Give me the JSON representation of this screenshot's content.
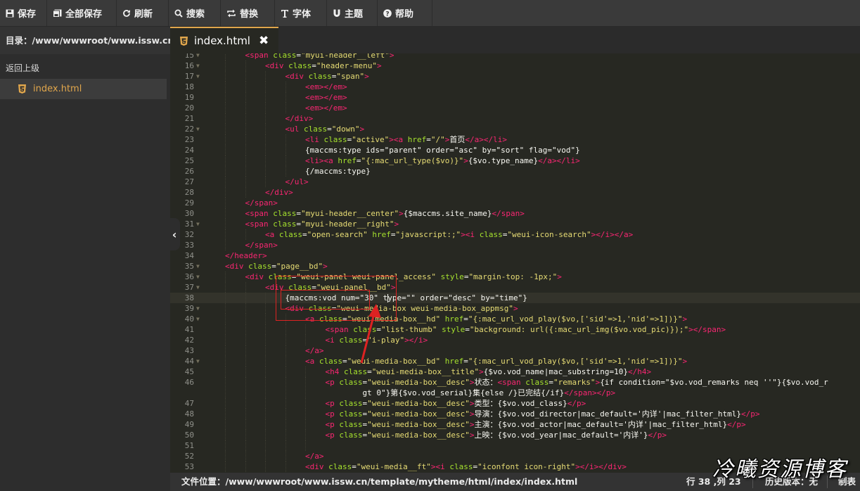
{
  "toolbar": {
    "buttons": [
      {
        "label": "保存",
        "icon": "save-icon"
      },
      {
        "label": "全部保存",
        "icon": "save-all-icon"
      },
      {
        "label": "刷新",
        "icon": "refresh-icon"
      },
      {
        "label": "搜索",
        "icon": "search-icon"
      },
      {
        "label": "替换",
        "icon": "replace-icon"
      },
      {
        "label": "字体",
        "icon": "font-icon"
      },
      {
        "label": "主题",
        "icon": "theme-icon"
      },
      {
        "label": "帮助",
        "icon": "help-icon"
      }
    ]
  },
  "sidebar": {
    "directory": "目录：/www/wwwroot/www.issw.cn/t...",
    "back_label": "返回上级",
    "files": [
      "index.html"
    ]
  },
  "tab": {
    "label": "index.html"
  },
  "editor": {
    "active_line": 38,
    "lines": [
      {
        "n": "15",
        "fold": true,
        "code": [
          [
            "t",
            "<span "
          ],
          [
            "a",
            "class"
          ],
          [
            "w",
            "="
          ],
          [
            "s",
            "\"myui-header__left\""
          ],
          [
            "t",
            ">"
          ]
        ]
      },
      {
        "n": "16",
        "fold": true,
        "code": [
          [
            "t",
            "<div "
          ],
          [
            "a",
            "class"
          ],
          [
            "w",
            "="
          ],
          [
            "s",
            "\"header-menu\""
          ],
          [
            "t",
            ">"
          ]
        ]
      },
      {
        "n": "17",
        "fold": true,
        "code": [
          [
            "t",
            "<div "
          ],
          [
            "a",
            "class"
          ],
          [
            "w",
            "="
          ],
          [
            "s",
            "\"span\""
          ],
          [
            "t",
            ">"
          ]
        ]
      },
      {
        "n": "18",
        "fold": false,
        "code": [
          [
            "t",
            "<em></em>"
          ]
        ]
      },
      {
        "n": "19",
        "fold": false,
        "code": [
          [
            "t",
            "<em></em>"
          ]
        ]
      },
      {
        "n": "20",
        "fold": false,
        "code": [
          [
            "t",
            "<em></em>"
          ]
        ]
      },
      {
        "n": "21",
        "fold": false,
        "code": [
          [
            "t",
            "</div>"
          ]
        ]
      },
      {
        "n": "22",
        "fold": true,
        "code": [
          [
            "t",
            "<ul "
          ],
          [
            "a",
            "class"
          ],
          [
            "w",
            "="
          ],
          [
            "s",
            "\"down\""
          ],
          [
            "t",
            ">"
          ]
        ]
      },
      {
        "n": "23",
        "fold": false,
        "code": [
          [
            "t",
            "<li "
          ],
          [
            "a",
            "class"
          ],
          [
            "w",
            "="
          ],
          [
            "s",
            "\"active\""
          ],
          [
            "t",
            "><a "
          ],
          [
            "a",
            "href"
          ],
          [
            "w",
            "="
          ],
          [
            "s",
            "\"/\""
          ],
          [
            "t",
            ">"
          ],
          [
            "w",
            "首页"
          ],
          [
            "t",
            "</a></li>"
          ]
        ]
      },
      {
        "n": "24",
        "fold": false,
        "code": [
          [
            "w",
            "{maccms:type ids=\"parent\" order=\"asc\" by=\"sort\" flag=\"vod\"}"
          ]
        ]
      },
      {
        "n": "25",
        "fold": false,
        "code": [
          [
            "t",
            "<li><a "
          ],
          [
            "a",
            "href"
          ],
          [
            "w",
            "="
          ],
          [
            "s",
            "\"{:mac_url_type($vo)}\""
          ],
          [
            "t",
            ">"
          ],
          [
            "w",
            "{$vo.type_name}"
          ],
          [
            "t",
            "</a></li>"
          ]
        ]
      },
      {
        "n": "26",
        "fold": false,
        "code": [
          [
            "w",
            "{/maccms:type}"
          ]
        ]
      },
      {
        "n": "27",
        "fold": false,
        "code": [
          [
            "t",
            "</ul>"
          ]
        ]
      },
      {
        "n": "28",
        "fold": false,
        "code": [
          [
            "t",
            "</div>"
          ]
        ]
      },
      {
        "n": "29",
        "fold": false,
        "code": [
          [
            "t",
            "</span>"
          ]
        ]
      },
      {
        "n": "30",
        "fold": false,
        "code": [
          [
            "t",
            "<span "
          ],
          [
            "a",
            "class"
          ],
          [
            "w",
            "="
          ],
          [
            "s",
            "\"myui-header__center\""
          ],
          [
            "t",
            ">"
          ],
          [
            "w",
            "{$maccms.site_name}"
          ],
          [
            "t",
            "</span>"
          ]
        ]
      },
      {
        "n": "31",
        "fold": true,
        "code": [
          [
            "t",
            "<span "
          ],
          [
            "a",
            "class"
          ],
          [
            "w",
            "="
          ],
          [
            "s",
            "\"myui-header__right\""
          ],
          [
            "t",
            ">"
          ]
        ]
      },
      {
        "n": "32",
        "fold": false,
        "code": [
          [
            "t",
            "<a "
          ],
          [
            "a",
            "class"
          ],
          [
            "w",
            "="
          ],
          [
            "s",
            "\"open-search\""
          ],
          [
            "a",
            " href"
          ],
          [
            "w",
            "="
          ],
          [
            "s",
            "\"javascript:;\""
          ],
          [
            "t",
            "><i "
          ],
          [
            "a",
            "class"
          ],
          [
            "w",
            "="
          ],
          [
            "s",
            "\"weui-icon-search\""
          ],
          [
            "t",
            "></i></a>"
          ]
        ]
      },
      {
        "n": "33",
        "fold": false,
        "code": [
          [
            "t",
            "</span>"
          ]
        ]
      },
      {
        "n": "34",
        "fold": false,
        "code": [
          [
            "t",
            "</header>"
          ]
        ]
      },
      {
        "n": "35",
        "fold": true,
        "code": [
          [
            "t",
            "<div "
          ],
          [
            "a",
            "class"
          ],
          [
            "w",
            "="
          ],
          [
            "s",
            "\"page__bd\""
          ],
          [
            "t",
            ">"
          ]
        ]
      },
      {
        "n": "36",
        "fold": true,
        "code": [
          [
            "t",
            "<div "
          ],
          [
            "a",
            "class"
          ],
          [
            "w",
            "="
          ],
          [
            "s",
            "\"weui-panel weui-panel_access\""
          ],
          [
            "a",
            " style"
          ],
          [
            "w",
            "="
          ],
          [
            "s",
            "\"margin-top: -1px;\""
          ],
          [
            "t",
            ">"
          ]
        ]
      },
      {
        "n": "37",
        "fold": true,
        "code": [
          [
            "t",
            "<div "
          ],
          [
            "a",
            "class"
          ],
          [
            "w",
            "="
          ],
          [
            "s",
            "\"weui-panel__bd\""
          ],
          [
            "t",
            ">"
          ]
        ]
      },
      {
        "n": "38",
        "fold": false,
        "code": [
          [
            "w",
            "{maccms:vod num=\"30\" type=\"\" order=\"desc\" by=\"time\"}"
          ]
        ]
      },
      {
        "n": "39",
        "fold": true,
        "code": [
          [
            "t",
            "<div "
          ],
          [
            "a",
            "class"
          ],
          [
            "w",
            "="
          ],
          [
            "s",
            "\"weui-media-box weui-media-box_appmsg\""
          ],
          [
            "t",
            ">"
          ]
        ]
      },
      {
        "n": "40",
        "fold": true,
        "code": [
          [
            "t",
            "<a "
          ],
          [
            "a",
            "class"
          ],
          [
            "w",
            "="
          ],
          [
            "s",
            "\"weui-media-box__hd\""
          ],
          [
            "a",
            " href"
          ],
          [
            "w",
            "="
          ],
          [
            "s",
            "\"{:mac_url_vod_play($vo,['sid'=>1,'nid'=>1])}\""
          ],
          [
            "t",
            ">"
          ]
        ]
      },
      {
        "n": "41",
        "fold": false,
        "code": [
          [
            "t",
            "<span "
          ],
          [
            "a",
            "class"
          ],
          [
            "w",
            "="
          ],
          [
            "s",
            "\"list-thumb\""
          ],
          [
            "a",
            " style"
          ],
          [
            "w",
            "="
          ],
          [
            "s",
            "\"background: url({:mac_url_img($vo.vod_pic)});\""
          ],
          [
            "t",
            "></span>"
          ]
        ]
      },
      {
        "n": "42",
        "fold": false,
        "code": [
          [
            "t",
            "<i "
          ],
          [
            "a",
            "class"
          ],
          [
            "w",
            "="
          ],
          [
            "s",
            "\"i-play\""
          ],
          [
            "t",
            "></i>"
          ]
        ]
      },
      {
        "n": "43",
        "fold": false,
        "code": [
          [
            "t",
            "</a>"
          ]
        ]
      },
      {
        "n": "44",
        "fold": true,
        "code": [
          [
            "t",
            "<a "
          ],
          [
            "a",
            "class"
          ],
          [
            "w",
            "="
          ],
          [
            "s",
            "\"weui-media-box__bd\""
          ],
          [
            "a",
            " href"
          ],
          [
            "w",
            "="
          ],
          [
            "s",
            "\"{:mac_url_vod_play($vo,['sid'=>1,'nid'=>1])}\""
          ],
          [
            "t",
            ">"
          ]
        ]
      },
      {
        "n": "45",
        "fold": false,
        "code": [
          [
            "t",
            "<h4 "
          ],
          [
            "a",
            "class"
          ],
          [
            "w",
            "="
          ],
          [
            "s",
            "\"weui-media-box__title\""
          ],
          [
            "t",
            ">"
          ],
          [
            "w",
            "{$vo.vod_name|mac_substring=10}"
          ],
          [
            "t",
            "</h4>"
          ]
        ]
      },
      {
        "n": "46",
        "fold": false,
        "tall": true,
        "code": [
          [
            "t",
            "<p "
          ],
          [
            "a",
            "class"
          ],
          [
            "w",
            "="
          ],
          [
            "s",
            "\"weui-media-box__desc\""
          ],
          [
            "t",
            ">"
          ],
          [
            "w",
            "状态："
          ],
          [
            "t",
            "<span "
          ],
          [
            "a",
            "class"
          ],
          [
            "w",
            "="
          ],
          [
            "s",
            "\"remarks\""
          ],
          [
            "t",
            ">"
          ],
          [
            "w",
            "{if condition=\"$vo.vod_remarks neq ''\"}{$vo.vod_r"
          ]
        ],
        "wrap": [
          [
            "w",
            "gt 0\"}第{$vo.vod_serial}集{else /}已完结{/if}"
          ],
          [
            "t",
            "</span></p>"
          ]
        ]
      },
      {
        "n": "47",
        "fold": false,
        "code": [
          [
            "t",
            "<p "
          ],
          [
            "a",
            "class"
          ],
          [
            "w",
            "="
          ],
          [
            "s",
            "\"weui-media-box__desc\""
          ],
          [
            "t",
            ">"
          ],
          [
            "w",
            "类型：{$vo.vod_class}"
          ],
          [
            "t",
            "</p>"
          ]
        ]
      },
      {
        "n": "48",
        "fold": false,
        "code": [
          [
            "t",
            "<p "
          ],
          [
            "a",
            "class"
          ],
          [
            "w",
            "="
          ],
          [
            "s",
            "\"weui-media-box__desc\""
          ],
          [
            "t",
            ">"
          ],
          [
            "w",
            "导演：{$vo.vod_director|mac_default='内详'|mac_filter_html}"
          ],
          [
            "t",
            "</p>"
          ]
        ]
      },
      {
        "n": "49",
        "fold": false,
        "code": [
          [
            "t",
            "<p "
          ],
          [
            "a",
            "class"
          ],
          [
            "w",
            "="
          ],
          [
            "s",
            "\"weui-media-box__desc\""
          ],
          [
            "t",
            ">"
          ],
          [
            "w",
            "主演：{$vo.vod_actor|mac_default='内详'|mac_filter_html}"
          ],
          [
            "t",
            "</p>"
          ]
        ]
      },
      {
        "n": "50",
        "fold": false,
        "code": [
          [
            "t",
            "<p "
          ],
          [
            "a",
            "class"
          ],
          [
            "w",
            "="
          ],
          [
            "s",
            "\"weui-media-box__desc\""
          ],
          [
            "t",
            ">"
          ],
          [
            "w",
            "上映：{$vo.vod_year|mac_default='内详'}"
          ],
          [
            "t",
            "</p>"
          ]
        ]
      },
      {
        "n": "51",
        "fold": false,
        "code": []
      },
      {
        "n": "52",
        "fold": false,
        "code": [
          [
            "t",
            "</a>"
          ]
        ]
      },
      {
        "n": "53",
        "fold": false,
        "code": [
          [
            "t",
            "<div "
          ],
          [
            "a",
            "class"
          ],
          [
            "w",
            "="
          ],
          [
            "s",
            "\"weui-media__ft\""
          ],
          [
            "t",
            "><i "
          ],
          [
            "a",
            "class"
          ],
          [
            "w",
            "="
          ],
          [
            "s",
            "\"iconfont icon-right\""
          ],
          [
            "t",
            "></i></div>"
          ]
        ]
      }
    ]
  },
  "status": {
    "file_location": "文件位置：/www/wwwroot/www.issw.cn/template/mytheme/html/index/index.html",
    "cursor_pos": "行 38 ,列 23",
    "history": "历史版本：无",
    "table": "制表"
  },
  "watermark": "冷曦资源博客",
  "colors": {
    "tag": "#f92672",
    "attr": "#a6e22e",
    "string": "#e6db74",
    "text": "#f8f8f2",
    "accent": "#e0a64c",
    "annotation": "#dd2222"
  }
}
